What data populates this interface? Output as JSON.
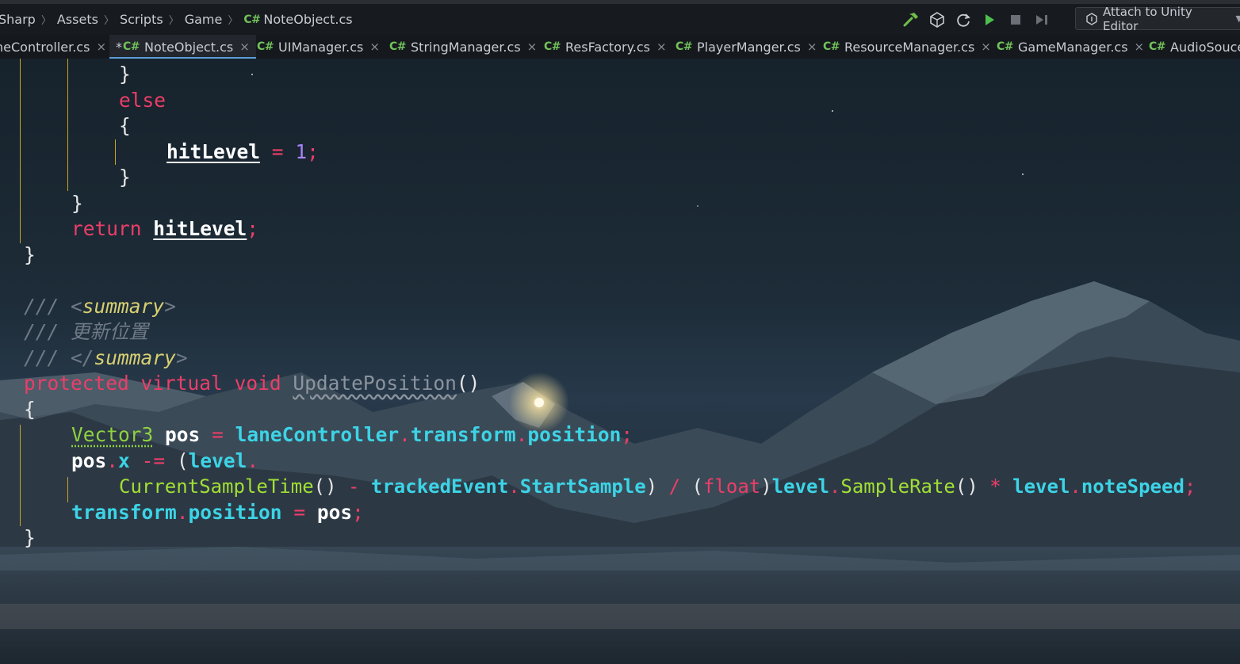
{
  "breadcrumb": {
    "items": [
      "Sharp",
      "Assets",
      "Scripts",
      "Game"
    ],
    "file_badge": "C#",
    "file": "NoteObject.cs"
  },
  "toolbar": {
    "build_icon": "hammer-icon",
    "unity_icon": "unity-icon",
    "refresh_icon": "refresh-icon",
    "play_icon": "play-icon",
    "stop_icon": "stop-icon",
    "step_icon": "step-icon",
    "attach_label": "Attach to Unity Editor"
  },
  "tabs": [
    {
      "label": "neController.cs",
      "badge": "",
      "modified": "",
      "close": "×"
    },
    {
      "label": "NoteObject.cs",
      "badge": "C#",
      "modified": "*",
      "close": "×",
      "active": true
    },
    {
      "label": "UIManager.cs",
      "badge": "C#",
      "modified": "",
      "close": "×"
    },
    {
      "label": "StringManager.cs",
      "badge": "C#",
      "modified": "",
      "close": "×"
    },
    {
      "label": "ResFactory.cs",
      "badge": "C#",
      "modified": "",
      "close": "×"
    },
    {
      "label": "PlayerManger.cs",
      "badge": "C#",
      "modified": "",
      "close": "×"
    },
    {
      "label": "ResourceManager.cs",
      "badge": "C#",
      "modified": "",
      "close": "×"
    },
    {
      "label": "GameManager.cs",
      "badge": "C#",
      "modified": "",
      "close": "×"
    },
    {
      "label": "AudioSouce",
      "badge": "C#",
      "modified": "",
      "close": ""
    }
  ],
  "code": {
    "l1": {
      "brace": "}"
    },
    "l2": {
      "kw": "else"
    },
    "l3": {
      "brace": "{"
    },
    "l4": {
      "var": "hitLevel",
      "op": "=",
      "num": "1",
      "semi": ";"
    },
    "l5": {
      "brace": "}"
    },
    "l6": {
      "brace": "}"
    },
    "l7": {
      "kw": "return",
      "var": "hitLevel",
      "semi": ";"
    },
    "l8": {
      "brace": "}"
    },
    "l9": {
      "slashes": "///",
      "open": "<",
      "tag": "summary",
      "close": ">"
    },
    "l10": {
      "slashes": "///",
      "text": "更新位置"
    },
    "l11": {
      "slashes": "///",
      "open": "</",
      "tag": "summary",
      "close": ">"
    },
    "l12": {
      "kw1": "protected",
      "kw2": "virtual",
      "kw3": "void",
      "name": "UpdatePosition",
      "parens": "()"
    },
    "l13": {
      "brace": "{"
    },
    "l14": {
      "type": "Vector3",
      "var": "pos",
      "op": "=",
      "obj": "laneController",
      "dot1": ".",
      "m1": "transform",
      "dot2": ".",
      "m2": "position",
      "semi": ";"
    },
    "l15": {
      "var": "pos",
      "dot": ".",
      "m": "x",
      "op": "-=",
      "paren": "(",
      "obj": "level",
      "dot2": "."
    },
    "l16": {
      "meth": "CurrentSampleTime",
      "parens": "()",
      "op1": "-",
      "obj": "trackedEvent",
      "dot": ".",
      "m": "StartSample",
      "cp": ")",
      "op2": "/",
      "op_paren": "(",
      "kw": "float",
      "cp2": ")",
      "obj2": "level",
      "dot2": ".",
      "meth2": "SampleRate",
      "parens2": "()",
      "op3": "*",
      "obj3": "level",
      "dot3": ".",
      "m3": "noteSpeed",
      "semi": ";"
    },
    "l17": {
      "obj": "transform",
      "dot": ".",
      "m": "position",
      "op": "=",
      "var": "pos",
      "semi": ";"
    },
    "l18": {
      "brace": "}"
    }
  },
  "colors": {
    "keyword": "#ec3e68",
    "type": "#8fd13f",
    "member": "#3cd4e6",
    "number": "#a783f7",
    "comment": "#6f7a86",
    "doc_tag": "#d7cf71",
    "tab_accent": "#5a9bd6"
  }
}
